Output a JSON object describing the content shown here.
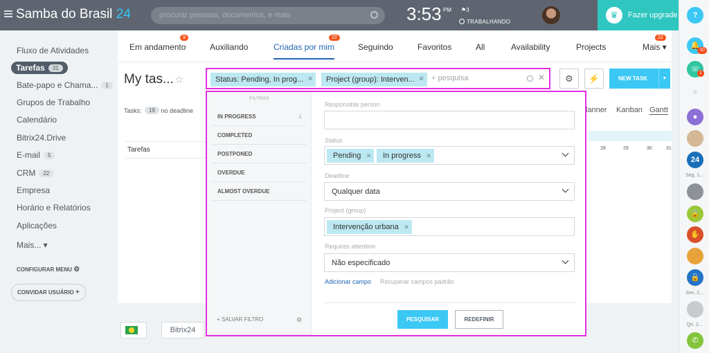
{
  "header": {
    "logo_main": "Samba do Brasil ",
    "logo_num": "24",
    "search_placeholder": "procurar pessoas, documentos, e mais",
    "clock": "3:53",
    "ampm": "PM",
    "flag_count": "3",
    "work_status": "TRABALHANDO",
    "upgrade_label": "Fazer upgrade"
  },
  "rightbar": {
    "help": "?",
    "badge1": "10",
    "badge2": "1",
    "b24": "24",
    "caption1": "Seg, 1...",
    "caption2": "Sex, 2...",
    "caption3": "Qrt. 2..."
  },
  "sidebar": {
    "items": [
      {
        "label": "Fluxo de Atividades"
      },
      {
        "label": "Tarefas",
        "count": "31"
      },
      {
        "label": "Bate-papo e Chama...",
        "count": "1"
      },
      {
        "label": "Grupos de Trabalho"
      },
      {
        "label": "Calendário"
      },
      {
        "label": "Bitrix24.Drive"
      },
      {
        "label": "E-mail",
        "count": "5"
      },
      {
        "label": "CRM",
        "count": "22"
      },
      {
        "label": "Empresa"
      },
      {
        "label": "Horário e Relatórios"
      },
      {
        "label": "Aplicações"
      },
      {
        "label": "Mais... ▾"
      }
    ],
    "configure": "CONFIGURAR MENU",
    "invite": "CONVIDAR USUÁRIO"
  },
  "tabs": [
    {
      "label": "Em andamento",
      "badge": "9"
    },
    {
      "label": "Auxiliando"
    },
    {
      "label": "Criadas por mim",
      "badge": "22"
    },
    {
      "label": "Seguindo"
    },
    {
      "label": "Favoritos"
    },
    {
      "label": "All"
    },
    {
      "label": "Availability"
    },
    {
      "label": "Projects"
    },
    {
      "label": "Mais ▾",
      "badge": "22"
    }
  ],
  "page": {
    "title": "My tas...",
    "chip1": "Status: Pending, In prog...",
    "chip2": "Project (group): Interven...",
    "search_placeholder": "+ pesquisa",
    "new_task": "NEW TASK",
    "tasks_label": "Tasks:",
    "tasks_count": "19",
    "no_deadline": "no deadline",
    "views": [
      "lanner",
      "Kanban",
      "Gantt"
    ],
    "gantt_days": [
      "28",
      "29",
      "30",
      "31"
    ],
    "row_label": "Tarefas",
    "b24_button": "Bitrix24"
  },
  "filter": {
    "header": "FILTROS",
    "presets": [
      "IN PROGRESS",
      "COMPLETED",
      "POSTPONED",
      "OVERDUE",
      "ALMOST OVERDUE"
    ],
    "save_filter": "SALVAR FILTRO",
    "responsible_label": "Responsible person",
    "status_label": "Status",
    "status_values": [
      "Pending",
      "In progress"
    ],
    "deadline_label": "Deadline",
    "deadline_value": "Qualquer data",
    "project_label": "Project (group)",
    "project_value": "Intervenção urbana",
    "attention_label": "Requires attention",
    "attention_value": "Não especificado",
    "add_field": "Adicionar campo",
    "restore_fields": "Recuperar campos padrão",
    "search_button": "PESQUISAR",
    "reset_button": "REDEFINIR"
  },
  "colors": {
    "accent": "#3bc8f5",
    "highlight": "#e52ce0",
    "topbar": "#5e6570",
    "upgrade": "#2fc6c0",
    "badge": "#f4561e"
  }
}
